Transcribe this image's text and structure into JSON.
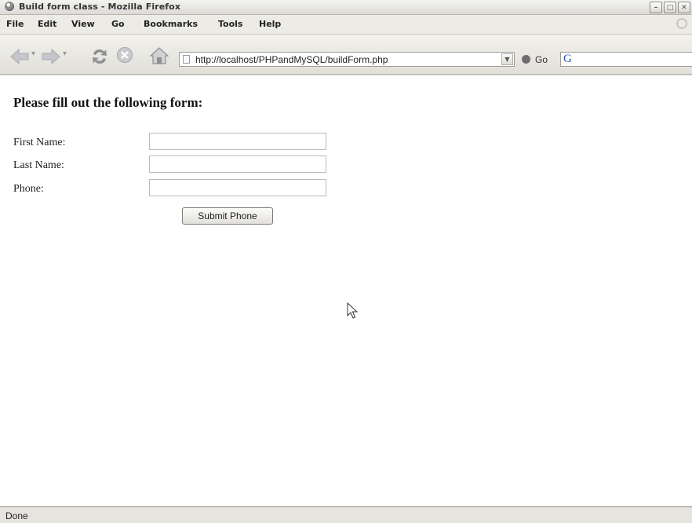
{
  "window": {
    "title": "Build form class - Mozilla Firefox",
    "controls": [
      "–",
      "□",
      "✕"
    ]
  },
  "menu": {
    "items": [
      "File",
      "Edit",
      "View",
      "Go",
      "Bookmarks",
      "Tools",
      "Help"
    ]
  },
  "toolbar": {
    "url": "http://localhost/PHPandMySQL/buildForm.php",
    "go_label": "Go",
    "search_engine": "G"
  },
  "page": {
    "heading": "Please fill out the following form:",
    "fields": [
      {
        "label": "First Name:",
        "value": ""
      },
      {
        "label": "Last Name:",
        "value": ""
      },
      {
        "label": "Phone:",
        "value": ""
      }
    ],
    "submit_label": "Submit Phone"
  },
  "status": {
    "text": "Done"
  },
  "colors": {
    "chrome": "#d4d0c8",
    "content_bg": "#ffffff",
    "link_blue": "#2a55a8"
  },
  "icons": [
    "back-icon",
    "forward-icon",
    "reload-icon",
    "stop-icon",
    "home-icon",
    "page-icon",
    "go-icon",
    "search-engine-icon",
    "pointer-cursor-icon"
  ]
}
